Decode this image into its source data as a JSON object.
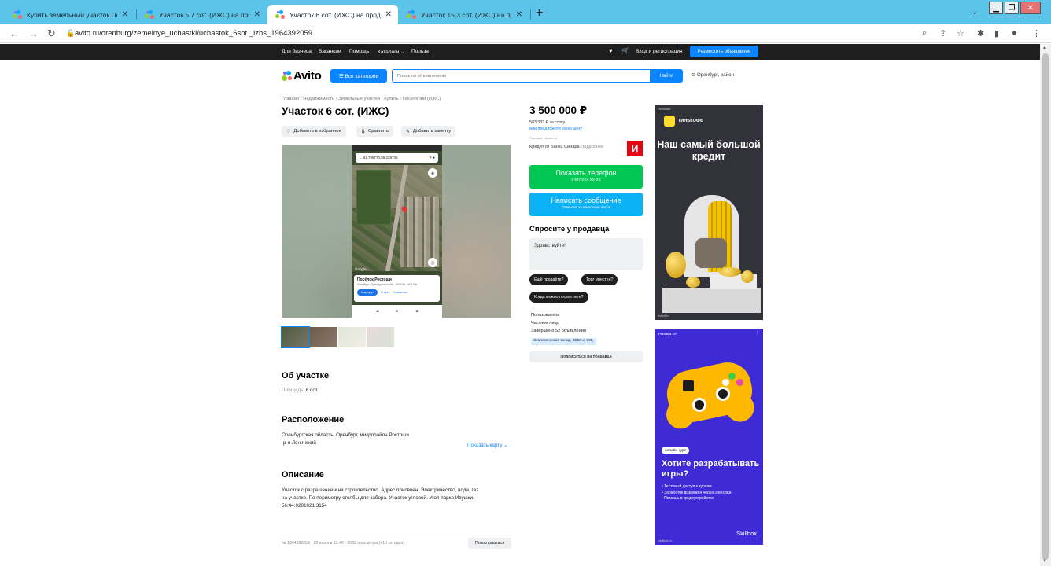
{
  "browser": {
    "tabs": [
      {
        "title": "Купить земельный участок Пос..."
      },
      {
        "title": "Участок 5,7 сот. (ИЖС) на прода..."
      },
      {
        "title": "Участок 6 сот. (ИЖС) на прода..."
      },
      {
        "title": "Участок 15,3 сот. (ИЖС) на про..."
      }
    ],
    "active_tab_index": 2,
    "new_tab": "+",
    "close_glyph": "✕",
    "url": "avito.ru/orenburg/zemelnye_uchastki/uchastok_6sot._izhs_1964392059"
  },
  "topnav": {
    "links": [
      "Для бизнеса",
      "Вакансии",
      "Помощь",
      "Каталоги ⌄",
      "Польза"
    ],
    "login": "Вход и регистрация",
    "post_ad": "Разместить объявление"
  },
  "header": {
    "logo": "Avito",
    "categories_button": "☰ Все категории",
    "search_placeholder": "Поиск по объявлениям",
    "search_button": "Найти",
    "location": "Оренбург, район"
  },
  "listing": {
    "breadcrumbs": "Главная › Недвижимость › Земельные участки › Купить › Поселений (ИЖС)",
    "title": "Участок 6 сот. (ИЖС)",
    "actions": {
      "favorite": "Добавить в избранное",
      "compare": "Сравнить",
      "note": "Добавить заметку"
    },
    "photo": {
      "search_text": "51.795770,55.228736",
      "place_name": "Посёлок Ростоши",
      "place_address": "Оренбург, Оренбургская обл., 460036 · 46 13 м",
      "route_btn": "Маршрут",
      "go_btn": "В путь",
      "save_btn": "Сохранить",
      "google": "Google"
    },
    "about_h": "Об участке",
    "area_label": "Площадь:",
    "area_value": "6 сот.",
    "location_h": "Расположение",
    "address_line1": "Оренбургская область, Оренбург, микрорайон Ростоши",
    "address_line2": "р-н Ленинский",
    "show_map": "Показать карту ⌄",
    "desc_h": "Описание",
    "desc_lines": [
      "Участок с разрешением на строительство. Адрес присвоен. Электричество, вода, газ",
      "на участке. По периметру столбы для забора. Участок угловой. Угол парка Ивушки.",
      "56:44:0201021:3154"
    ],
    "meta": "№ 1964392059 · 28 июля в 12:46 · 3582 просмотра (+10 сегодня)",
    "complain": "Пожаловаться"
  },
  "sidebar": {
    "price": "3 500 000 ₽",
    "price_per_unit": "583 333 ₽ за сотку",
    "offer_price": "или предложите свою цену",
    "ad_small": "Реклама · sinara.ru",
    "credit": "Кредит от Банка Синара",
    "credit_more": "Подробнее",
    "show_phone": "Показать телефон",
    "phone_masked": "8 987 XXX-XX-XX",
    "write_msg": "Написать сообщение",
    "reply_time": "Отвечает за несколько часов",
    "ask_h": "Спросите у продавца",
    "ask_text": "Здравствуйте!",
    "chips": [
      "Ещё продаёте?",
      "Торг уместен?",
      "Когда можно посмотреть?"
    ],
    "seller_name": "Пользователь",
    "seller_type": "Частное лицо",
    "seller_done": "Завершено 52 объявления",
    "eco": "Экологический вклад -2550 кг CO₂",
    "subscribe": "Подписаться на продавца"
  },
  "ads": {
    "ad1": {
      "label": "Реклама",
      "brand": "ТИНЬКОФФ",
      "headline": "Наш самый большой кредит",
      "source": "tinkoff.ru"
    },
    "ad2": {
      "label": "Реклама  18+",
      "pill": "онлайн-курс",
      "headline": "Хотите разрабатывать игры?",
      "bullets": [
        "Тестовый доступ к курсам",
        "Заработок возможен через 3 месяца",
        "Помощь в трудоустройстве"
      ],
      "brand": "Skillbox",
      "source": "skillbox.ru"
    }
  },
  "colors": {
    "accent": "#0a84ff",
    "green": "#00c853",
    "cyan": "#0ab1f5",
    "topbar": "#1e1e1e",
    "tabbar": "#5bc4e8"
  }
}
